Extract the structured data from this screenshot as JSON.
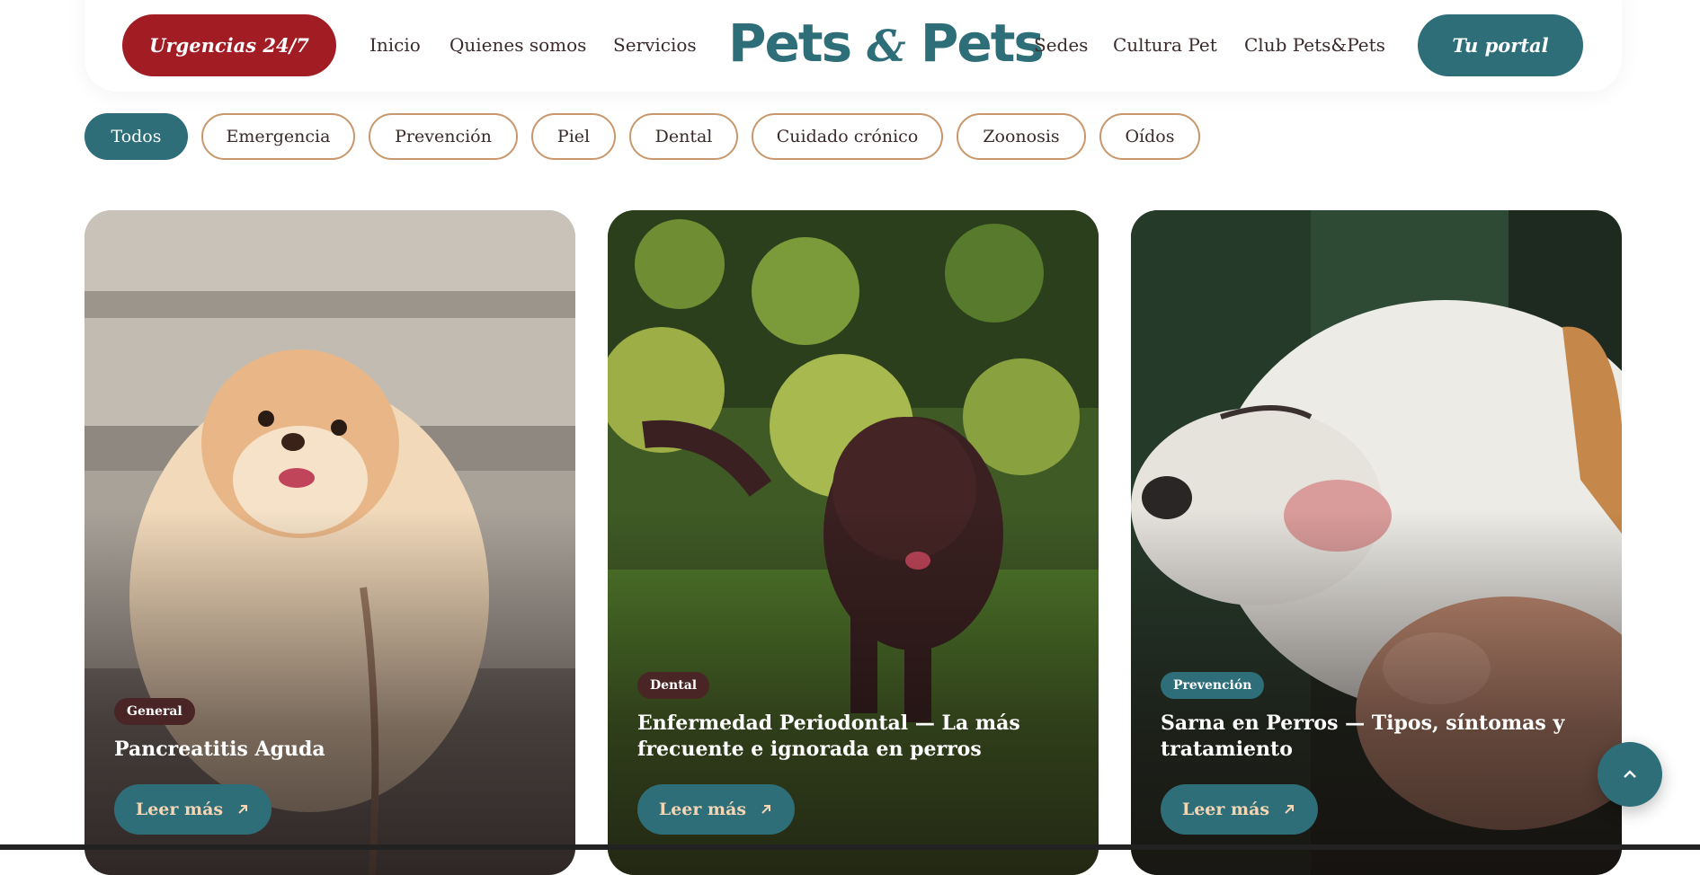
{
  "header": {
    "urgent_label": "Urgencias 24/7",
    "portal_label": "Tu portal",
    "logo_part1": "Pets",
    "logo_amp": "&",
    "logo_part2": "Pets",
    "nav_left": [
      "Inicio",
      "Quienes somos",
      "Servicios"
    ],
    "nav_right": [
      "Sedes",
      "Cultura Pet",
      "Club Pets&Pets"
    ]
  },
  "filters": [
    {
      "label": "Todos",
      "active": true
    },
    {
      "label": "Emergencia",
      "active": false
    },
    {
      "label": "Prevención",
      "active": false
    },
    {
      "label": "Piel",
      "active": false
    },
    {
      "label": "Dental",
      "active": false
    },
    {
      "label": "Cuidado crónico",
      "active": false
    },
    {
      "label": "Zoonosis",
      "active": false
    },
    {
      "label": "Oídos",
      "active": false
    }
  ],
  "cards": [
    {
      "tag": "General",
      "title": "Pancreatitis Aguda",
      "cta": "Leer más"
    },
    {
      "tag": "Dental",
      "title": "Enfermedad Periodontal — La más frecuente e ignorada en perros",
      "cta": "Leer más"
    },
    {
      "tag": "Prevención",
      "title": "Sarna en Perros — Tipos, síntomas y tratamiento",
      "cta": "Leer más"
    }
  ],
  "colors": {
    "teal": "#2d6e78",
    "red": "#a21c24",
    "tan": "#c8976b",
    "dark_tag": "#4a2525"
  },
  "icons": {
    "card_cta": "arrow-up-right-icon",
    "scroll": "chevron-up-icon"
  }
}
